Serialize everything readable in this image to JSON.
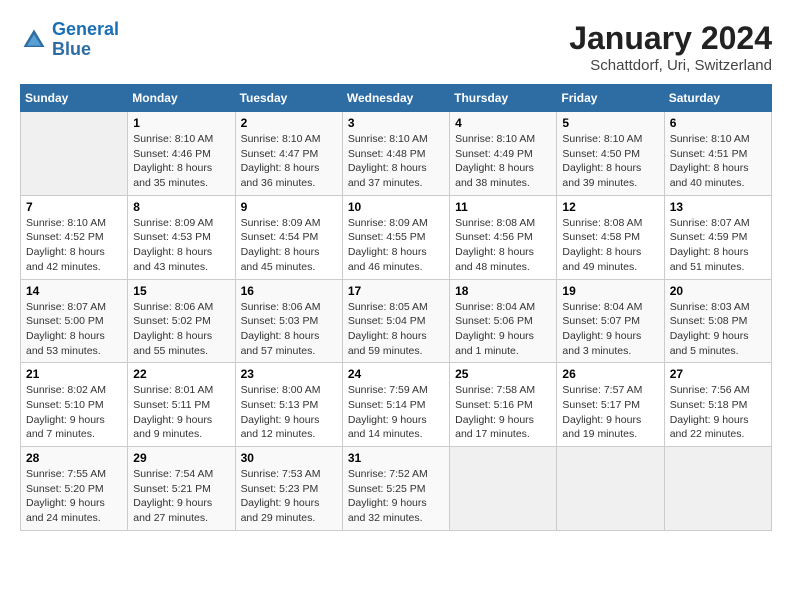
{
  "header": {
    "logo_line1": "General",
    "logo_line2": "Blue",
    "title": "January 2024",
    "subtitle": "Schattdorf, Uri, Switzerland"
  },
  "weekdays": [
    "Sunday",
    "Monday",
    "Tuesday",
    "Wednesday",
    "Thursday",
    "Friday",
    "Saturday"
  ],
  "weeks": [
    [
      {
        "day": "",
        "info": ""
      },
      {
        "day": "1",
        "info": "Sunrise: 8:10 AM\nSunset: 4:46 PM\nDaylight: 8 hours\nand 35 minutes."
      },
      {
        "day": "2",
        "info": "Sunrise: 8:10 AM\nSunset: 4:47 PM\nDaylight: 8 hours\nand 36 minutes."
      },
      {
        "day": "3",
        "info": "Sunrise: 8:10 AM\nSunset: 4:48 PM\nDaylight: 8 hours\nand 37 minutes."
      },
      {
        "day": "4",
        "info": "Sunrise: 8:10 AM\nSunset: 4:49 PM\nDaylight: 8 hours\nand 38 minutes."
      },
      {
        "day": "5",
        "info": "Sunrise: 8:10 AM\nSunset: 4:50 PM\nDaylight: 8 hours\nand 39 minutes."
      },
      {
        "day": "6",
        "info": "Sunrise: 8:10 AM\nSunset: 4:51 PM\nDaylight: 8 hours\nand 40 minutes."
      }
    ],
    [
      {
        "day": "7",
        "info": "Sunrise: 8:10 AM\nSunset: 4:52 PM\nDaylight: 8 hours\nand 42 minutes."
      },
      {
        "day": "8",
        "info": "Sunrise: 8:09 AM\nSunset: 4:53 PM\nDaylight: 8 hours\nand 43 minutes."
      },
      {
        "day": "9",
        "info": "Sunrise: 8:09 AM\nSunset: 4:54 PM\nDaylight: 8 hours\nand 45 minutes."
      },
      {
        "day": "10",
        "info": "Sunrise: 8:09 AM\nSunset: 4:55 PM\nDaylight: 8 hours\nand 46 minutes."
      },
      {
        "day": "11",
        "info": "Sunrise: 8:08 AM\nSunset: 4:56 PM\nDaylight: 8 hours\nand 48 minutes."
      },
      {
        "day": "12",
        "info": "Sunrise: 8:08 AM\nSunset: 4:58 PM\nDaylight: 8 hours\nand 49 minutes."
      },
      {
        "day": "13",
        "info": "Sunrise: 8:07 AM\nSunset: 4:59 PM\nDaylight: 8 hours\nand 51 minutes."
      }
    ],
    [
      {
        "day": "14",
        "info": "Sunrise: 8:07 AM\nSunset: 5:00 PM\nDaylight: 8 hours\nand 53 minutes."
      },
      {
        "day": "15",
        "info": "Sunrise: 8:06 AM\nSunset: 5:02 PM\nDaylight: 8 hours\nand 55 minutes."
      },
      {
        "day": "16",
        "info": "Sunrise: 8:06 AM\nSunset: 5:03 PM\nDaylight: 8 hours\nand 57 minutes."
      },
      {
        "day": "17",
        "info": "Sunrise: 8:05 AM\nSunset: 5:04 PM\nDaylight: 8 hours\nand 59 minutes."
      },
      {
        "day": "18",
        "info": "Sunrise: 8:04 AM\nSunset: 5:06 PM\nDaylight: 9 hours\nand 1 minute."
      },
      {
        "day": "19",
        "info": "Sunrise: 8:04 AM\nSunset: 5:07 PM\nDaylight: 9 hours\nand 3 minutes."
      },
      {
        "day": "20",
        "info": "Sunrise: 8:03 AM\nSunset: 5:08 PM\nDaylight: 9 hours\nand 5 minutes."
      }
    ],
    [
      {
        "day": "21",
        "info": "Sunrise: 8:02 AM\nSunset: 5:10 PM\nDaylight: 9 hours\nand 7 minutes."
      },
      {
        "day": "22",
        "info": "Sunrise: 8:01 AM\nSunset: 5:11 PM\nDaylight: 9 hours\nand 9 minutes."
      },
      {
        "day": "23",
        "info": "Sunrise: 8:00 AM\nSunset: 5:13 PM\nDaylight: 9 hours\nand 12 minutes."
      },
      {
        "day": "24",
        "info": "Sunrise: 7:59 AM\nSunset: 5:14 PM\nDaylight: 9 hours\nand 14 minutes."
      },
      {
        "day": "25",
        "info": "Sunrise: 7:58 AM\nSunset: 5:16 PM\nDaylight: 9 hours\nand 17 minutes."
      },
      {
        "day": "26",
        "info": "Sunrise: 7:57 AM\nSunset: 5:17 PM\nDaylight: 9 hours\nand 19 minutes."
      },
      {
        "day": "27",
        "info": "Sunrise: 7:56 AM\nSunset: 5:18 PM\nDaylight: 9 hours\nand 22 minutes."
      }
    ],
    [
      {
        "day": "28",
        "info": "Sunrise: 7:55 AM\nSunset: 5:20 PM\nDaylight: 9 hours\nand 24 minutes."
      },
      {
        "day": "29",
        "info": "Sunrise: 7:54 AM\nSunset: 5:21 PM\nDaylight: 9 hours\nand 27 minutes."
      },
      {
        "day": "30",
        "info": "Sunrise: 7:53 AM\nSunset: 5:23 PM\nDaylight: 9 hours\nand 29 minutes."
      },
      {
        "day": "31",
        "info": "Sunrise: 7:52 AM\nSunset: 5:25 PM\nDaylight: 9 hours\nand 32 minutes."
      },
      {
        "day": "",
        "info": ""
      },
      {
        "day": "",
        "info": ""
      },
      {
        "day": "",
        "info": ""
      }
    ]
  ]
}
